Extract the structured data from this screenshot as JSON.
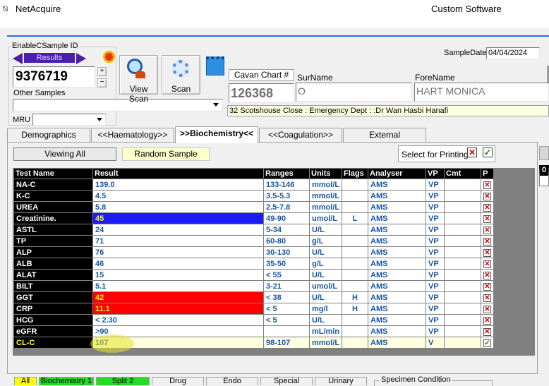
{
  "window": {
    "title": "NetAcquire",
    "vendor": "Custom Software"
  },
  "sample": {
    "group_label": "EnableCSample ID",
    "results_label": "Results",
    "id_value": "9376719",
    "other_samples_label": "Other Samples",
    "mru_label": "MRU",
    "view_scan_label": "View Scan",
    "scan_label": "Scan",
    "sample_date_label": "SampleDate",
    "sample_date_value": "04/04/2024"
  },
  "patient": {
    "chart_label": "Cavan Chart #",
    "chart_value": "126368",
    "surname_label": "SurName",
    "surname_value": "O",
    "forename_label": "ForeName",
    "forename_value": "HART MONICA",
    "address": "32 Scotshouse Close : Emergency Dept : :Dr Wan Hasbi Hanafi"
  },
  "tabs": [
    "Demographics",
    "<<Haematology>>",
    ">>Biochemistry<<",
    "<<Coagulation>>",
    "External"
  ],
  "toolbar": {
    "viewing_all": "Viewing All",
    "random_sample": "Random Sample",
    "select_printing": "Select for Printing"
  },
  "table": {
    "headers": [
      "Test Name",
      "Result",
      "Ranges",
      "Units",
      "Flags",
      "Analyser",
      "VP",
      "Cmt",
      "P"
    ],
    "rows": [
      {
        "name": "NA-C",
        "result": "139.0",
        "range": "133-146",
        "units": "mmol/L",
        "flag": "",
        "analyser": "AMS",
        "vp": "VP",
        "p": "x"
      },
      {
        "name": "K-C",
        "result": "4.5",
        "range": "3.5-5.3",
        "units": "mmol/L",
        "flag": "",
        "analyser": "AMS",
        "vp": "VP",
        "p": "x"
      },
      {
        "name": "UREA",
        "result": "5.8",
        "range": "2.5-7.8",
        "units": "mmol/L",
        "flag": "",
        "analyser": "AMS",
        "vp": "VP",
        "p": "x"
      },
      {
        "name": "Creatinine.",
        "result": "45",
        "range": "49-90",
        "units": "umol/L",
        "flag": "L",
        "analyser": "AMS",
        "vp": "VP",
        "p": "x",
        "bg": "#1a1aff",
        "fg": "#ffff00"
      },
      {
        "name": "ASTL",
        "result": "24",
        "range": "5-34",
        "units": "U/L",
        "flag": "",
        "analyser": "AMS",
        "vp": "VP",
        "p": "x"
      },
      {
        "name": "TP",
        "result": "71",
        "range": "60-80",
        "units": "g/L",
        "flag": "",
        "analyser": "AMS",
        "vp": "VP",
        "p": "x"
      },
      {
        "name": "ALP",
        "result": "76",
        "range": "30-130",
        "units": "U/L",
        "flag": "",
        "analyser": "AMS",
        "vp": "VP",
        "p": "x"
      },
      {
        "name": "ALB",
        "result": "46",
        "range": "35-50",
        "units": "g/L",
        "flag": "",
        "analyser": "AMS",
        "vp": "VP",
        "p": "x"
      },
      {
        "name": "ALAT",
        "result": "15",
        "range": "< 55",
        "units": "U/L",
        "flag": "",
        "analyser": "AMS",
        "vp": "VP",
        "p": "x"
      },
      {
        "name": "BILT",
        "result": "5.1",
        "range": "3-21",
        "units": "umol/L",
        "flag": "",
        "analyser": "AMS",
        "vp": "VP",
        "p": "x"
      },
      {
        "name": "GGT",
        "result": "42",
        "range": "< 38",
        "units": "U/L",
        "flag": "H",
        "analyser": "AMS",
        "vp": "VP",
        "p": "x",
        "bg": "#ff0000",
        "fg": "#ffff00"
      },
      {
        "name": "CRP",
        "result": "11.1",
        "range": "< 5",
        "units": "mg/l",
        "flag": "H",
        "analyser": "AMS",
        "vp": "VP",
        "p": "x",
        "bg": "#ff0000",
        "fg": "#ffff00"
      },
      {
        "name": "HCG",
        "result": "< 2.30",
        "range": "< 5",
        "units": "U/L",
        "flag": "",
        "analyser": "AMS",
        "vp": "VP",
        "p": "x"
      },
      {
        "name": "eGFR",
        "result": ">90",
        "range": "",
        "units": "mL/min",
        "flag": "",
        "analyser": "AMS",
        "vp": "VP",
        "p": "x"
      },
      {
        "name": "CL-C",
        "result": "107",
        "range": "98-107",
        "units": "mmol/L",
        "flag": "",
        "analyser": "AMS",
        "vp": "V",
        "p": "ok",
        "highlight": true
      }
    ]
  },
  "side_box_text": "0",
  "bottom_tabs": [
    {
      "label": "All",
      "color": "#ffff00"
    },
    {
      "label": "Biochemistry 1",
      "color": "#22dd22"
    },
    {
      "label": "Split 2",
      "color": "#22dd22"
    },
    {
      "label": "Drug",
      "color": "#f0f0f0"
    },
    {
      "label": "Endo",
      "color": "#f0f0f0"
    },
    {
      "label": "Special",
      "color": "#f0f0f0"
    },
    {
      "label": "Urinary",
      "color": "#f0f0f0"
    }
  ],
  "specimen_condition": "Specimen Condition"
}
